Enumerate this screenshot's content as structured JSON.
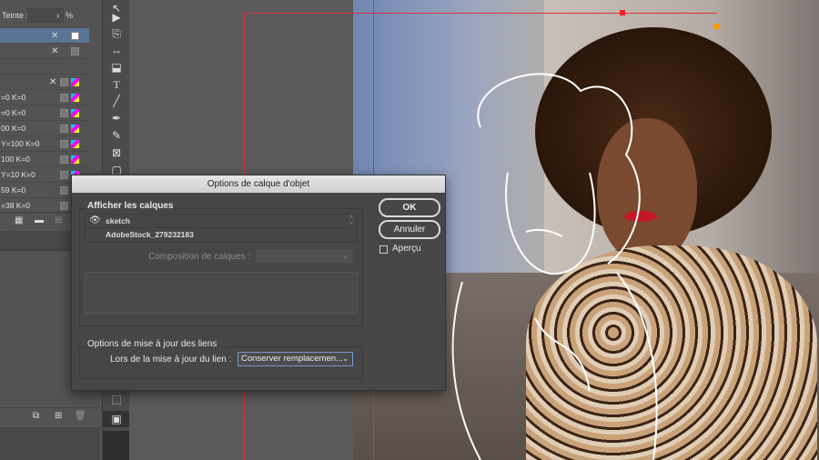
{
  "swatches": {
    "tint_label": "Teinte :",
    "tint_unit": "%",
    "rows": [
      "",
      "",
      "",
      "",
      "=0 K=0",
      "=0 K=0",
      "00 K=0",
      "Y=100 K=0",
      "100 K=0",
      "Y=10 K=0",
      "59 K=0",
      "=38 K=0"
    ]
  },
  "dialog": {
    "title": "Options de calque d'objet",
    "show_layers_label": "Afficher les calques",
    "layers": [
      "sketch",
      "AdobeStock_279232183"
    ],
    "layer_comp_label": "Composition de calques :",
    "layer_comp_value": "",
    "link_options_label": "Options de mise à jour des liens",
    "link_update_label": "Lors de la mise à jour du lien :",
    "link_update_value": "Conserver remplacemen...",
    "ok": "OK",
    "cancel": "Annuler",
    "preview": "Aperçu"
  },
  "colors": {
    "accent": "#5a7595",
    "guide": "#d33"
  }
}
